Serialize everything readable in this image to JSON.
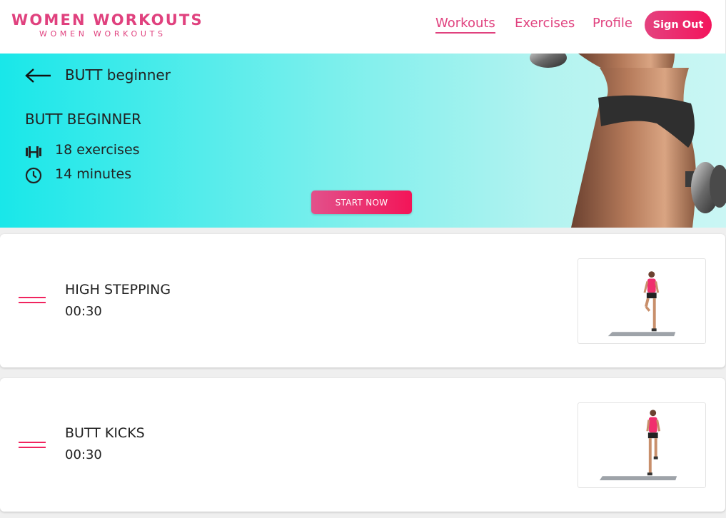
{
  "header": {
    "logo": "WOMEN WORKOUTS",
    "logo_sub": "WOMEN WORKOUTS",
    "nav": [
      {
        "label": "Workouts",
        "active": true
      },
      {
        "label": "Exercises",
        "active": false
      },
      {
        "label": "Profile",
        "active": false
      }
    ],
    "signout_label": "Sign Out"
  },
  "hero": {
    "back_label": "BUTT beginner",
    "title": "BUTT BEGINNER",
    "exercises": "18 exercises",
    "minutes": "14 minutes",
    "start_label": "START NOW",
    "icons": [
      "back-arrow-icon",
      "dumbbell-icon",
      "clock-icon"
    ]
  },
  "exercises": [
    {
      "name": "HIGH STEPPING",
      "duration": "00:30"
    },
    {
      "name": "BUTT KICKS",
      "duration": "00:30"
    }
  ],
  "colors": {
    "accent": "#e0417e",
    "button_gradient_start": "#e4427f",
    "button_gradient_end": "#f3145c",
    "hero_gradient_start": "#19e7e9",
    "hero_gradient_end": "#caf6f4",
    "handle": "#f0245f"
  }
}
